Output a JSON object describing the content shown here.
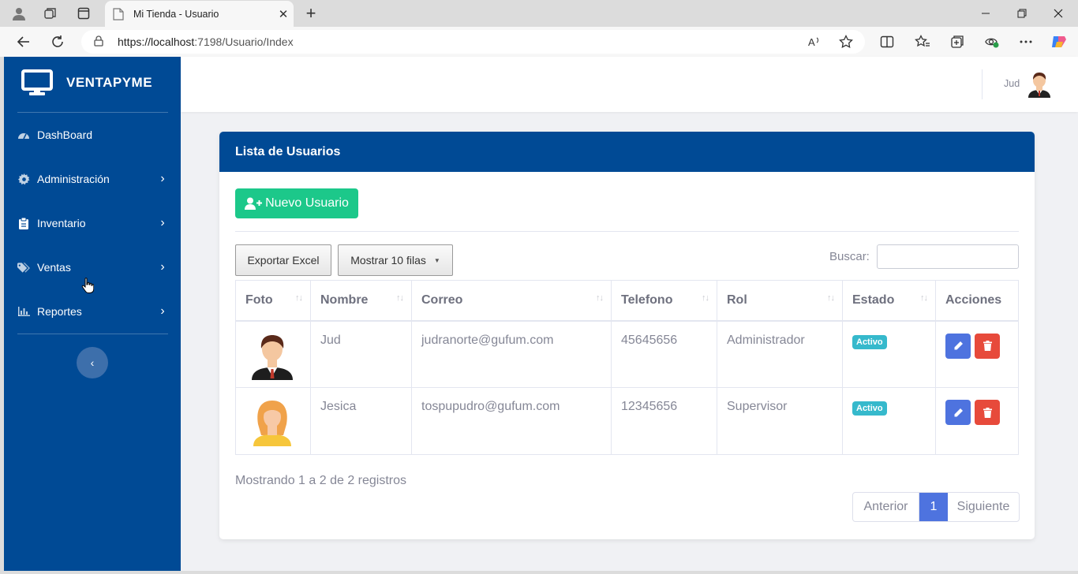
{
  "browser": {
    "tab_title": "Mi Tienda - Usuario",
    "tab_close": "✕",
    "new_tab": "+",
    "url_host": "https://localhost",
    "url_path": ":7198/Usuario/Index"
  },
  "sidebar": {
    "brand": "VENTAPYME",
    "items": [
      {
        "label": "DashBoard",
        "icon": "dashboard-icon",
        "has_submenu": false
      },
      {
        "label": "Administración",
        "icon": "gear-icon",
        "has_submenu": true
      },
      {
        "label": "Inventario",
        "icon": "clipboard-icon",
        "has_submenu": true
      },
      {
        "label": "Ventas",
        "icon": "tags-icon",
        "has_submenu": true
      },
      {
        "label": "Reportes",
        "icon": "chart-icon",
        "has_submenu": true
      }
    ],
    "toggle_icon": "‹"
  },
  "topbar": {
    "user_name": "Jud"
  },
  "card": {
    "title": "Lista de Usuarios",
    "new_button": "Nuevo Usuario",
    "export_button": "Exportar Excel",
    "rows_button": "Mostrar 10 filas",
    "rows_caret": "▼",
    "search_label": "Buscar:",
    "search_value": ""
  },
  "table": {
    "headers": [
      "Foto",
      "Nombre",
      "Correo",
      "Telefono",
      "Rol",
      "Estado",
      "Acciones"
    ],
    "sort_glyph": "↑↓",
    "rows": [
      {
        "nombre": "Jud",
        "correo": "judranorte@gufum.com",
        "telefono": "45645656",
        "rol": "Administrador",
        "estado": "Activo",
        "foto": "male-avatar"
      },
      {
        "nombre": "Jesica",
        "correo": "tospupudro@gufum.com",
        "telefono": "12345656",
        "rol": "Supervisor",
        "estado": "Activo",
        "foto": "female-avatar"
      }
    ]
  },
  "footer": {
    "info": "Mostrando 1 a 2 de 2 registros",
    "prev": "Anterior",
    "page": "1",
    "next": "Siguiente"
  },
  "colors": {
    "sidebar": "#004a95",
    "success": "#1cc88a",
    "primary": "#4e73df",
    "danger": "#e74a3b",
    "info": "#36b9cc"
  }
}
